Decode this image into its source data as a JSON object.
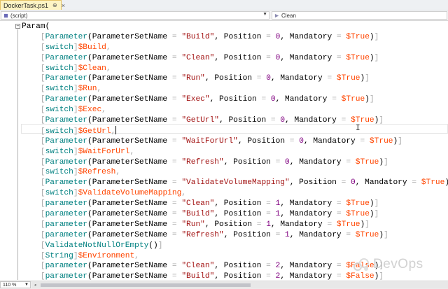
{
  "tab": {
    "title": "DockerTask.ps1",
    "pin": "⊕",
    "close": "×"
  },
  "navbar": {
    "left_value": "(script)",
    "right_value": "Clean"
  },
  "editor": {
    "lines": [
      [
        [
          "fn",
          "Param("
        ]
      ],
      [
        [
          "br",
          "    ["
        ],
        [
          "ty",
          "Parameter"
        ],
        [
          "fn",
          "(ParameterSetName "
        ],
        [
          "op",
          "="
        ],
        [
          "fn",
          " "
        ],
        [
          "str",
          "\"Build\""
        ],
        [
          "fn",
          ", Position "
        ],
        [
          "op",
          "="
        ],
        [
          "fn",
          " "
        ],
        [
          "num",
          "0"
        ],
        [
          "fn",
          ", Mandatory "
        ],
        [
          "op",
          "="
        ],
        [
          "fn",
          " "
        ],
        [
          "var",
          "$True"
        ],
        [
          "fn",
          ")"
        ],
        [
          "br",
          "]"
        ]
      ],
      [
        [
          "br",
          "    ["
        ],
        [
          "ty",
          "switch"
        ],
        [
          "br",
          "]"
        ],
        [
          "var",
          "$Build"
        ],
        [
          "op",
          ","
        ]
      ],
      [
        [
          "br",
          "    ["
        ],
        [
          "ty",
          "Parameter"
        ],
        [
          "fn",
          "(ParameterSetName "
        ],
        [
          "op",
          "="
        ],
        [
          "fn",
          " "
        ],
        [
          "str",
          "\"Clean\""
        ],
        [
          "fn",
          ", Position "
        ],
        [
          "op",
          "="
        ],
        [
          "fn",
          " "
        ],
        [
          "num",
          "0"
        ],
        [
          "fn",
          ", Mandatory "
        ],
        [
          "op",
          "="
        ],
        [
          "fn",
          " "
        ],
        [
          "var",
          "$True"
        ],
        [
          "fn",
          ")"
        ],
        [
          "br",
          "]"
        ]
      ],
      [
        [
          "br",
          "    ["
        ],
        [
          "ty",
          "switch"
        ],
        [
          "br",
          "]"
        ],
        [
          "var",
          "$Clean"
        ],
        [
          "op",
          ","
        ]
      ],
      [
        [
          "br",
          "    ["
        ],
        [
          "ty",
          "Parameter"
        ],
        [
          "fn",
          "(ParameterSetName "
        ],
        [
          "op",
          "="
        ],
        [
          "fn",
          " "
        ],
        [
          "str",
          "\"Run\""
        ],
        [
          "fn",
          ", Position "
        ],
        [
          "op",
          "="
        ],
        [
          "fn",
          " "
        ],
        [
          "num",
          "0"
        ],
        [
          "fn",
          ", Mandatory "
        ],
        [
          "op",
          "="
        ],
        [
          "fn",
          " "
        ],
        [
          "var",
          "$True"
        ],
        [
          "fn",
          ")"
        ],
        [
          "br",
          "]"
        ]
      ],
      [
        [
          "br",
          "    ["
        ],
        [
          "ty",
          "switch"
        ],
        [
          "br",
          "]"
        ],
        [
          "var",
          "$Run"
        ],
        [
          "op",
          ","
        ]
      ],
      [
        [
          "br",
          "    ["
        ],
        [
          "ty",
          "Parameter"
        ],
        [
          "fn",
          "(ParameterSetName "
        ],
        [
          "op",
          "="
        ],
        [
          "fn",
          " "
        ],
        [
          "str",
          "\"Exec\""
        ],
        [
          "fn",
          ", Position "
        ],
        [
          "op",
          "="
        ],
        [
          "fn",
          " "
        ],
        [
          "num",
          "0"
        ],
        [
          "fn",
          ", Mandatory "
        ],
        [
          "op",
          "="
        ],
        [
          "fn",
          " "
        ],
        [
          "var",
          "$True"
        ],
        [
          "fn",
          ")"
        ],
        [
          "br",
          "]"
        ]
      ],
      [
        [
          "br",
          "    ["
        ],
        [
          "ty",
          "switch"
        ],
        [
          "br",
          "]"
        ],
        [
          "var",
          "$Exec"
        ],
        [
          "op",
          ","
        ]
      ],
      [
        [
          "br",
          "    ["
        ],
        [
          "ty",
          "Parameter"
        ],
        [
          "fn",
          "(ParameterSetName "
        ],
        [
          "op",
          "="
        ],
        [
          "fn",
          " "
        ],
        [
          "str",
          "\"GetUrl\""
        ],
        [
          "fn",
          ", Position "
        ],
        [
          "op",
          "="
        ],
        [
          "fn",
          " "
        ],
        [
          "num",
          "0"
        ],
        [
          "fn",
          ", Mandatory "
        ],
        [
          "op",
          "="
        ],
        [
          "fn",
          " "
        ],
        [
          "var",
          "$True"
        ],
        [
          "fn",
          ")"
        ],
        [
          "br",
          "]"
        ]
      ],
      [
        [
          "br",
          "    ["
        ],
        [
          "ty",
          "switch"
        ],
        [
          "br",
          "]"
        ],
        [
          "var",
          "$GetUrl"
        ],
        [
          "op",
          ","
        ]
      ],
      [
        [
          "br",
          "    ["
        ],
        [
          "ty",
          "Parameter"
        ],
        [
          "fn",
          "(ParameterSetName "
        ],
        [
          "op",
          "="
        ],
        [
          "fn",
          " "
        ],
        [
          "str",
          "\"WaitForUrl\""
        ],
        [
          "fn",
          ", Position "
        ],
        [
          "op",
          "="
        ],
        [
          "fn",
          " "
        ],
        [
          "num",
          "0"
        ],
        [
          "fn",
          ", Mandatory "
        ],
        [
          "op",
          "="
        ],
        [
          "fn",
          " "
        ],
        [
          "var",
          "$True"
        ],
        [
          "fn",
          ")"
        ],
        [
          "br",
          "]"
        ]
      ],
      [
        [
          "br",
          "    ["
        ],
        [
          "ty",
          "switch"
        ],
        [
          "br",
          "]"
        ],
        [
          "var",
          "$WaitForUrl"
        ],
        [
          "op",
          ","
        ]
      ],
      [
        [
          "br",
          "    ["
        ],
        [
          "ty",
          "Parameter"
        ],
        [
          "fn",
          "(ParameterSetName "
        ],
        [
          "op",
          "="
        ],
        [
          "fn",
          " "
        ],
        [
          "str",
          "\"Refresh\""
        ],
        [
          "fn",
          ", Position "
        ],
        [
          "op",
          "="
        ],
        [
          "fn",
          " "
        ],
        [
          "num",
          "0"
        ],
        [
          "fn",
          ", Mandatory "
        ],
        [
          "op",
          "="
        ],
        [
          "fn",
          " "
        ],
        [
          "var",
          "$True"
        ],
        [
          "fn",
          ")"
        ],
        [
          "br",
          "]"
        ]
      ],
      [
        [
          "br",
          "    ["
        ],
        [
          "ty",
          "switch"
        ],
        [
          "br",
          "]"
        ],
        [
          "var",
          "$Refresh"
        ],
        [
          "op",
          ","
        ]
      ],
      [
        [
          "br",
          "    ["
        ],
        [
          "ty",
          "Parameter"
        ],
        [
          "fn",
          "(ParameterSetName "
        ],
        [
          "op",
          "="
        ],
        [
          "fn",
          " "
        ],
        [
          "str",
          "\"ValidateVolumeMapping\""
        ],
        [
          "fn",
          ", Position "
        ],
        [
          "op",
          "="
        ],
        [
          "fn",
          " "
        ],
        [
          "num",
          "0"
        ],
        [
          "fn",
          ", Mandatory "
        ],
        [
          "op",
          "="
        ],
        [
          "fn",
          " "
        ],
        [
          "var",
          "$True"
        ],
        [
          "fn",
          ")"
        ],
        [
          "br",
          "]"
        ]
      ],
      [
        [
          "br",
          "    ["
        ],
        [
          "ty",
          "switch"
        ],
        [
          "br",
          "]"
        ],
        [
          "var",
          "$ValidateVolumeMapping"
        ],
        [
          "op",
          ","
        ]
      ],
      [
        [
          "br",
          "    ["
        ],
        [
          "ty",
          "parameter"
        ],
        [
          "fn",
          "(ParameterSetName "
        ],
        [
          "op",
          "="
        ],
        [
          "fn",
          " "
        ],
        [
          "str",
          "\"Clean\""
        ],
        [
          "fn",
          ", Position "
        ],
        [
          "op",
          "="
        ],
        [
          "fn",
          " "
        ],
        [
          "num",
          "1"
        ],
        [
          "fn",
          ", Mandatory "
        ],
        [
          "op",
          "="
        ],
        [
          "fn",
          " "
        ],
        [
          "var",
          "$True"
        ],
        [
          "fn",
          ")"
        ],
        [
          "br",
          "]"
        ]
      ],
      [
        [
          "br",
          "    ["
        ],
        [
          "ty",
          "parameter"
        ],
        [
          "fn",
          "(ParameterSetName "
        ],
        [
          "op",
          "="
        ],
        [
          "fn",
          " "
        ],
        [
          "str",
          "\"Build\""
        ],
        [
          "fn",
          ", Position "
        ],
        [
          "op",
          "="
        ],
        [
          "fn",
          " "
        ],
        [
          "num",
          "1"
        ],
        [
          "fn",
          ", Mandatory "
        ],
        [
          "op",
          "="
        ],
        [
          "fn",
          " "
        ],
        [
          "var",
          "$True"
        ],
        [
          "fn",
          ")"
        ],
        [
          "br",
          "]"
        ]
      ],
      [
        [
          "br",
          "    ["
        ],
        [
          "ty",
          "parameter"
        ],
        [
          "fn",
          "(ParameterSetName "
        ],
        [
          "op",
          "="
        ],
        [
          "fn",
          " "
        ],
        [
          "str",
          "\"Run\""
        ],
        [
          "fn",
          ", Position "
        ],
        [
          "op",
          "="
        ],
        [
          "fn",
          " "
        ],
        [
          "num",
          "1"
        ],
        [
          "fn",
          ", Mandatory "
        ],
        [
          "op",
          "="
        ],
        [
          "fn",
          " "
        ],
        [
          "var",
          "$True"
        ],
        [
          "fn",
          ")"
        ],
        [
          "br",
          "]"
        ]
      ],
      [
        [
          "br",
          "    ["
        ],
        [
          "ty",
          "parameter"
        ],
        [
          "fn",
          "(ParameterSetName "
        ],
        [
          "op",
          "="
        ],
        [
          "fn",
          " "
        ],
        [
          "str",
          "\"Refresh\""
        ],
        [
          "fn",
          ", Position "
        ],
        [
          "op",
          "="
        ],
        [
          "fn",
          " "
        ],
        [
          "num",
          "1"
        ],
        [
          "fn",
          ", Mandatory "
        ],
        [
          "op",
          "="
        ],
        [
          "fn",
          " "
        ],
        [
          "var",
          "$True"
        ],
        [
          "fn",
          ")"
        ],
        [
          "br",
          "]"
        ]
      ],
      [
        [
          "br",
          "    ["
        ],
        [
          "ty",
          "ValidateNotNullOrEmpty"
        ],
        [
          "fn",
          "()"
        ],
        [
          "br",
          "]"
        ]
      ],
      [
        [
          "br",
          "    ["
        ],
        [
          "ty",
          "String"
        ],
        [
          "br",
          "]"
        ],
        [
          "var",
          "$Environment"
        ],
        [
          "op",
          ","
        ]
      ],
      [
        [
          "br",
          "    ["
        ],
        [
          "ty",
          "parameter"
        ],
        [
          "fn",
          "(ParameterSetName "
        ],
        [
          "op",
          "="
        ],
        [
          "fn",
          " "
        ],
        [
          "str",
          "\"Clean\""
        ],
        [
          "fn",
          ", Position "
        ],
        [
          "op",
          "="
        ],
        [
          "fn",
          " "
        ],
        [
          "num",
          "2"
        ],
        [
          "fn",
          ", Mandatory "
        ],
        [
          "op",
          "="
        ],
        [
          "fn",
          " "
        ],
        [
          "var",
          "$False"
        ],
        [
          "fn",
          ")"
        ],
        [
          "br",
          "]"
        ]
      ],
      [
        [
          "br",
          "    ["
        ],
        [
          "ty",
          "parameter"
        ],
        [
          "fn",
          "(ParameterSetName "
        ],
        [
          "op",
          "="
        ],
        [
          "fn",
          " "
        ],
        [
          "str",
          "\"Build\""
        ],
        [
          "fn",
          ", Position "
        ],
        [
          "op",
          "="
        ],
        [
          "fn",
          " "
        ],
        [
          "num",
          "2"
        ],
        [
          "fn",
          ", Mandatory "
        ],
        [
          "op",
          "="
        ],
        [
          "fn",
          " "
        ],
        [
          "var",
          "$False"
        ],
        [
          "fn",
          ")"
        ],
        [
          "br",
          "]"
        ]
      ]
    ]
  },
  "statusbar": {
    "zoom": "110 %"
  },
  "watermark": {
    "text": "DevOps"
  },
  "colors": {
    "keyword": "#0000ff",
    "type": "#008080",
    "string": "#a31515",
    "number": "#800080",
    "variable": "#ff4500",
    "operator": "#a9a9a9"
  }
}
